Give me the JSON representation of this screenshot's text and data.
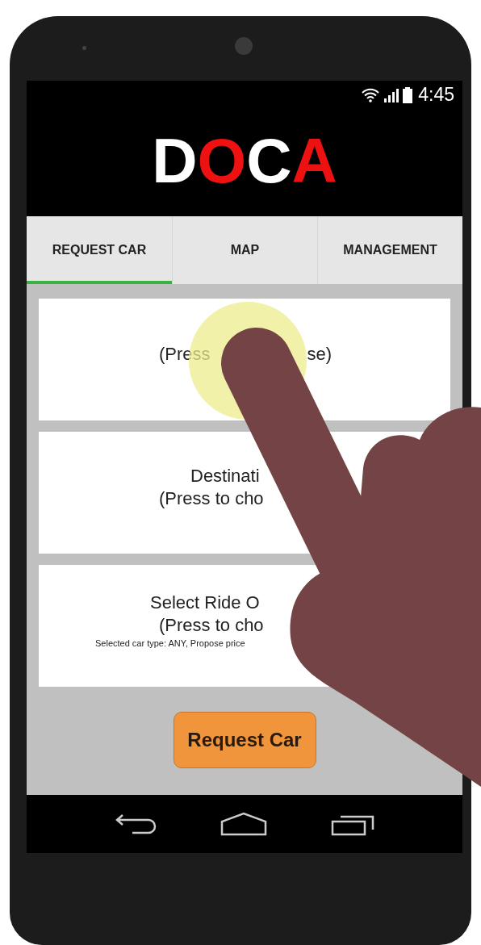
{
  "status_bar": {
    "time": "4:45"
  },
  "logo": {
    "letters": [
      {
        "text": "D",
        "color": "#ffffff"
      },
      {
        "text": "O",
        "color": "#ee1111"
      },
      {
        "text": "C",
        "color": "#ffffff"
      },
      {
        "text": "A",
        "color": "#ee1111"
      }
    ]
  },
  "tabs": [
    {
      "label": "REQUEST CAR",
      "selected": true
    },
    {
      "label": "MAP",
      "selected": false
    },
    {
      "label": "MANAGEMENT",
      "selected": false
    }
  ],
  "cards": [
    {
      "lines": [
        {
          "kind": "split",
          "left": "(Press",
          "right": "se)"
        }
      ]
    },
    {
      "lines": [
        {
          "kind": "main",
          "text": "Destinati"
        },
        {
          "kind": "main",
          "text": "(Press to cho"
        }
      ]
    },
    {
      "lines": [
        {
          "kind": "main",
          "text": "Select Ride O"
        },
        {
          "kind": "main",
          "text": "(Press to cho"
        },
        {
          "kind": "note",
          "text": "Selected car type: ANY, Propose price"
        }
      ]
    }
  ],
  "request_button": {
    "label": "Request Car"
  }
}
